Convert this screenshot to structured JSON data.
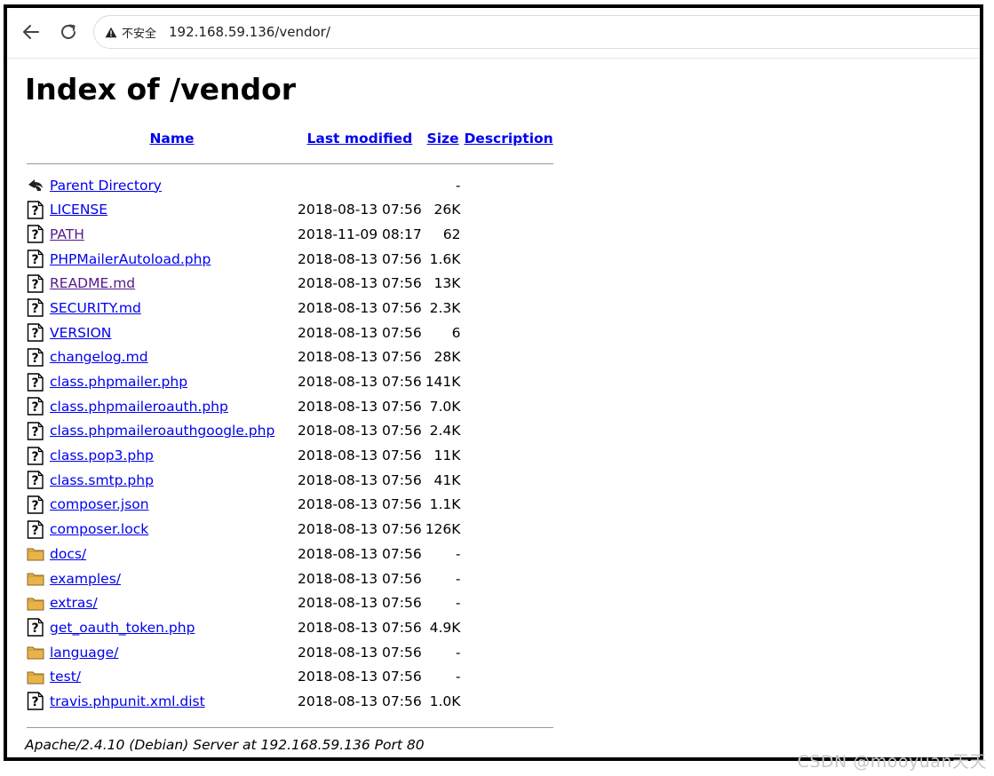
{
  "browser": {
    "security_label": "不安全",
    "url": "192.168.59.136/vendor/"
  },
  "page": {
    "title": "Index of /vendor",
    "headers": {
      "name": "Name",
      "last_modified": "Last modified",
      "size": "Size",
      "description": "Description"
    },
    "rows": [
      {
        "type": "parent",
        "name": "Parent Directory",
        "date": "",
        "size": "-",
        "visited": false
      },
      {
        "type": "file",
        "name": "LICENSE",
        "date": "2018-08-13 07:56",
        "size": "26K",
        "visited": false
      },
      {
        "type": "file",
        "name": "PATH",
        "date": "2018-11-09 08:17",
        "size": "62",
        "visited": true
      },
      {
        "type": "file",
        "name": "PHPMailerAutoload.php",
        "date": "2018-08-13 07:56",
        "size": "1.6K",
        "visited": false
      },
      {
        "type": "file",
        "name": "README.md",
        "date": "2018-08-13 07:56",
        "size": "13K",
        "visited": true
      },
      {
        "type": "file",
        "name": "SECURITY.md",
        "date": "2018-08-13 07:56",
        "size": "2.3K",
        "visited": false
      },
      {
        "type": "file",
        "name": "VERSION",
        "date": "2018-08-13 07:56",
        "size": "6",
        "visited": false
      },
      {
        "type": "file",
        "name": "changelog.md",
        "date": "2018-08-13 07:56",
        "size": "28K",
        "visited": false
      },
      {
        "type": "file",
        "name": "class.phpmailer.php",
        "date": "2018-08-13 07:56",
        "size": "141K",
        "visited": false
      },
      {
        "type": "file",
        "name": "class.phpmaileroauth.php",
        "date": "2018-08-13 07:56",
        "size": "7.0K",
        "visited": false
      },
      {
        "type": "file",
        "name": "class.phpmaileroauthgoogle.php",
        "date": "2018-08-13 07:56",
        "size": "2.4K",
        "visited": false
      },
      {
        "type": "file",
        "name": "class.pop3.php",
        "date": "2018-08-13 07:56",
        "size": "11K",
        "visited": false
      },
      {
        "type": "file",
        "name": "class.smtp.php",
        "date": "2018-08-13 07:56",
        "size": "41K",
        "visited": false
      },
      {
        "type": "file",
        "name": "composer.json",
        "date": "2018-08-13 07:56",
        "size": "1.1K",
        "visited": false
      },
      {
        "type": "file",
        "name": "composer.lock",
        "date": "2018-08-13 07:56",
        "size": "126K",
        "visited": false
      },
      {
        "type": "folder",
        "name": "docs/",
        "date": "2018-08-13 07:56",
        "size": "-",
        "visited": false
      },
      {
        "type": "folder",
        "name": "examples/",
        "date": "2018-08-13 07:56",
        "size": "-",
        "visited": false
      },
      {
        "type": "folder",
        "name": "extras/",
        "date": "2018-08-13 07:56",
        "size": "-",
        "visited": false
      },
      {
        "type": "file",
        "name": "get_oauth_token.php",
        "date": "2018-08-13 07:56",
        "size": "4.9K",
        "visited": false
      },
      {
        "type": "folder",
        "name": "language/",
        "date": "2018-08-13 07:56",
        "size": "-",
        "visited": false
      },
      {
        "type": "folder",
        "name": "test/",
        "date": "2018-08-13 07:56",
        "size": "-",
        "visited": false
      },
      {
        "type": "file",
        "name": "travis.phpunit.xml.dist",
        "date": "2018-08-13 07:56",
        "size": "1.0K",
        "visited": false
      }
    ],
    "footer": "Apache/2.4.10 (Debian) Server at 192.168.59.136 Port 80"
  },
  "watermark": "CSDN @mooyuan天天",
  "icons": {
    "back": "arrow-left-icon",
    "reload": "reload-icon",
    "warning": "warning-triangle-icon",
    "parent": "back-arrow-icon",
    "file": "unknown-file-icon",
    "folder": "folder-icon"
  },
  "colors": {
    "link": "#0000ee",
    "visited": "#551a8b",
    "folder": "#e8b44a"
  }
}
